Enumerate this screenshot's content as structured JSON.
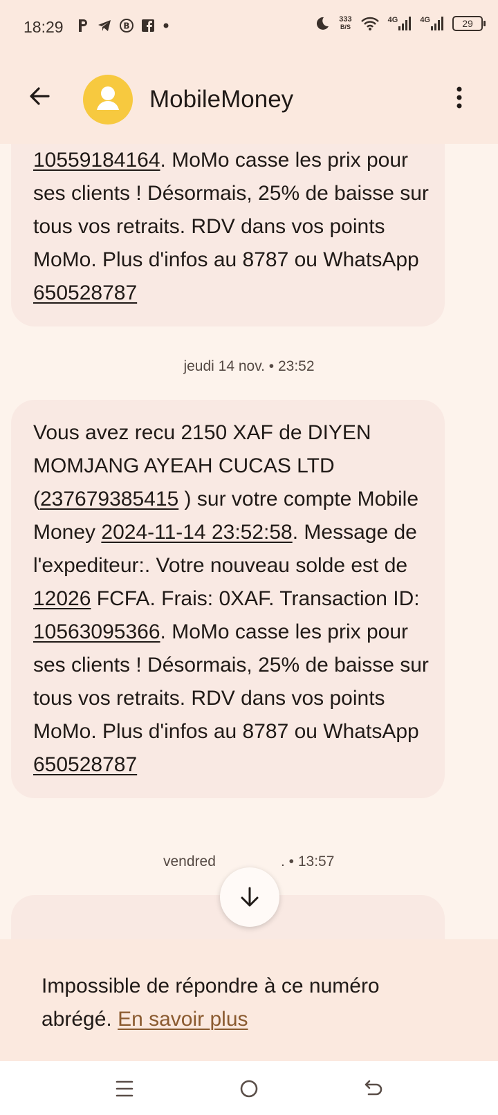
{
  "status_bar": {
    "time": "18:29",
    "left_icons": [
      "p-icon",
      "telegram-icon",
      "b-circle-icon",
      "fb-icon",
      "dot-icon"
    ],
    "speed_value": "333",
    "speed_unit": "B/S",
    "network1": "4G",
    "network2": "4G",
    "battery": "29"
  },
  "header": {
    "title": "MobileMoney",
    "avatar_color": "#f7c93f"
  },
  "messages": [
    {
      "partial": true,
      "link_id": "10559184164",
      "text1": ". MoMo casse les prix pour ses clients ! Désormais, 25% de baisse sur tous vos retraits. RDV dans vos points MoMo. Plus d'infos au 8787 ou WhatsApp ",
      "whatsapp": "650528787"
    },
    {
      "timestamp": "jeudi 14 nov. • 23:52",
      "p1": "Vous avez recu 2150 XAF de DIYEN MOMJANG AYEAH CUCAS LTD (",
      "phone": "237679385415",
      "p2": " ) sur votre compte Mobile Money ",
      "datetime": "2024-11-14 23:52:58",
      "p3": ". Message de l'expediteur:. Votre nouveau solde est de ",
      "balance": "12026",
      "p4": " FCFA. Frais: 0XAF. Transaction ID: ",
      "transaction_id": "10563095366",
      "p5": ". MoMo casse les prix pour ses clients ! Désormais, 25% de baisse sur tous vos retraits. RDV dans vos points MoMo. Plus d'infos au 8787 ou WhatsApp ",
      "whatsapp": "650528787"
    },
    {
      "timestamp_left": "vendred",
      "timestamp_right": ". • 13:57"
    }
  ],
  "reply_banner": {
    "text": "Impossible de répondre à ce numéro abrégé. ",
    "link": "En savoir plus"
  },
  "colors": {
    "bar_bg": "#fbe9df",
    "bubble_bg": "#f9e9e3",
    "page_bg": "#fdf3ec",
    "link": "#8a5a2f"
  }
}
